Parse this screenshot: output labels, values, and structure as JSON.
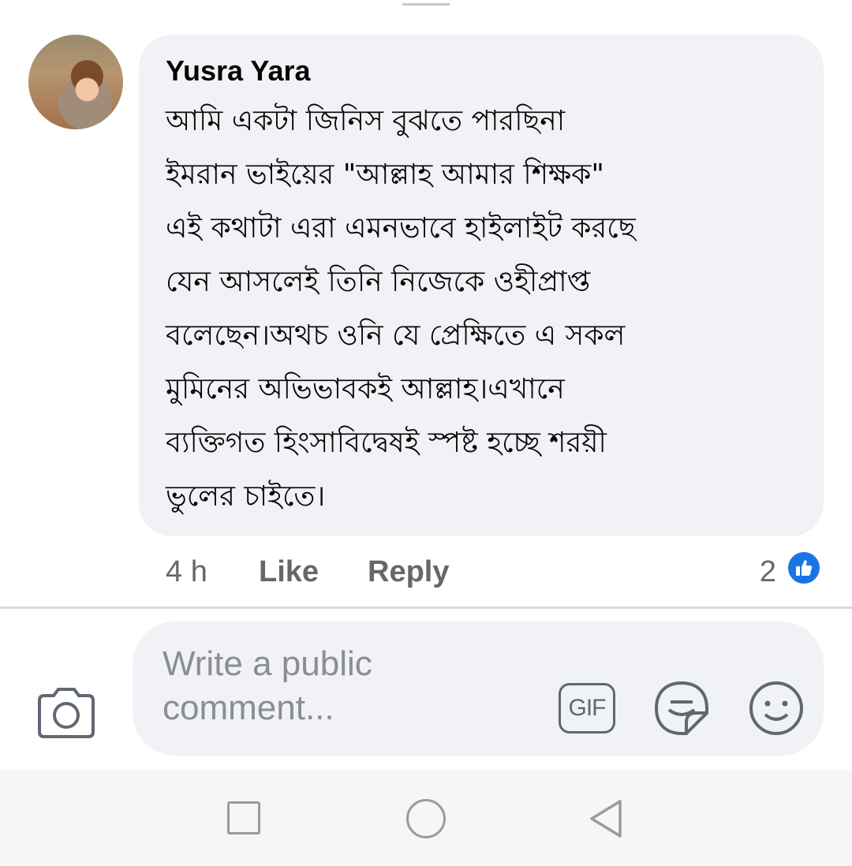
{
  "comment": {
    "author": "Yusra Yara",
    "lines": [
      "আমি একটা জিনিস বুঝতে পারছিনা",
      "ইমরান ভাইয়ের \"আল্লাহ আমার শিক্ষক\"",
      "এই কথাটা এরা এমনভাবে হাইলাইট করছে",
      "যেন আসলেই তিনি নিজেকে ওহীপ্রাপ্ত",
      "বলেছেন।অথচ ওনি যে প্রেক্ষিতে  এ সকল",
      "মুমিনের অভিভাবকই আল্লাহ।এখানে",
      "ব্যক্তিগত হিংসাবিদ্বেষই স্পষ্ট হচ্ছে শরয়ী",
      "ভুলের চাইতে।"
    ],
    "timestamp": "4 h",
    "like_label": "Like",
    "reply_label": "Reply",
    "reaction_count": "2",
    "reaction_icon": "like-thumb-icon"
  },
  "composer": {
    "placeholder_line1": "Write a public",
    "placeholder_line2": "comment...",
    "camera_icon": "camera-icon",
    "gif_label": "GIF",
    "sticker_icon": "sticker-icon",
    "emoji_icon": "emoji-icon"
  },
  "navbar": {
    "recent_icon": "square-icon",
    "home_icon": "circle-icon",
    "back_icon": "triangle-back-icon"
  },
  "colors": {
    "bubble_bg": "#f0f2f5",
    "secondary_text": "#65676b",
    "like_blue": "#1b74e4",
    "navbar_bg": "#f6f6f6"
  }
}
